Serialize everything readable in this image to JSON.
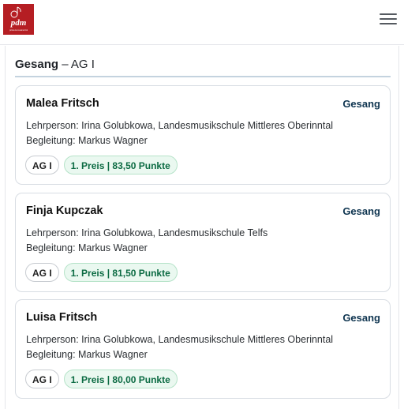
{
  "header": {
    "logo_text": "pdm",
    "logo_subtext": "prima la musica tirol",
    "menu_icon": "hamburger-menu-icon"
  },
  "section": {
    "category": "Gesang",
    "separator": " – ",
    "group": "AG I"
  },
  "cards": [
    {
      "name": "Malea Fritsch",
      "category": "Gesang",
      "teacher": "Lehrperson: Irina Golubkowa, Landesmusikschule Mittleres Oberinntal",
      "accompaniment": "Begleitung: Markus Wagner",
      "group_badge": "AG I",
      "prize_badge": "1. Preis | 83,50 Punkte"
    },
    {
      "name": "Finja Kupczak",
      "category": "Gesang",
      "teacher": "Lehrperson: Irina Golubkowa, Landesmusikschule Telfs",
      "accompaniment": "Begleitung: Markus Wagner",
      "group_badge": "AG I",
      "prize_badge": "1. Preis | 81,50 Punkte"
    },
    {
      "name": "Luisa Fritsch",
      "category": "Gesang",
      "teacher": "Lehrperson: Irina Golubkowa, Landesmusikschule Mittleres Oberinntal",
      "accompaniment": "Begleitung: Markus Wagner",
      "group_badge": "AG I",
      "prize_badge": "1. Preis | 80,00 Punkte"
    }
  ],
  "colors": {
    "logo_bg": "#b51e23",
    "category_tag": "#0f3550",
    "prize_bg": "#eaf8f0",
    "prize_text": "#0c6b43",
    "title_underline": "#c4d3df"
  }
}
